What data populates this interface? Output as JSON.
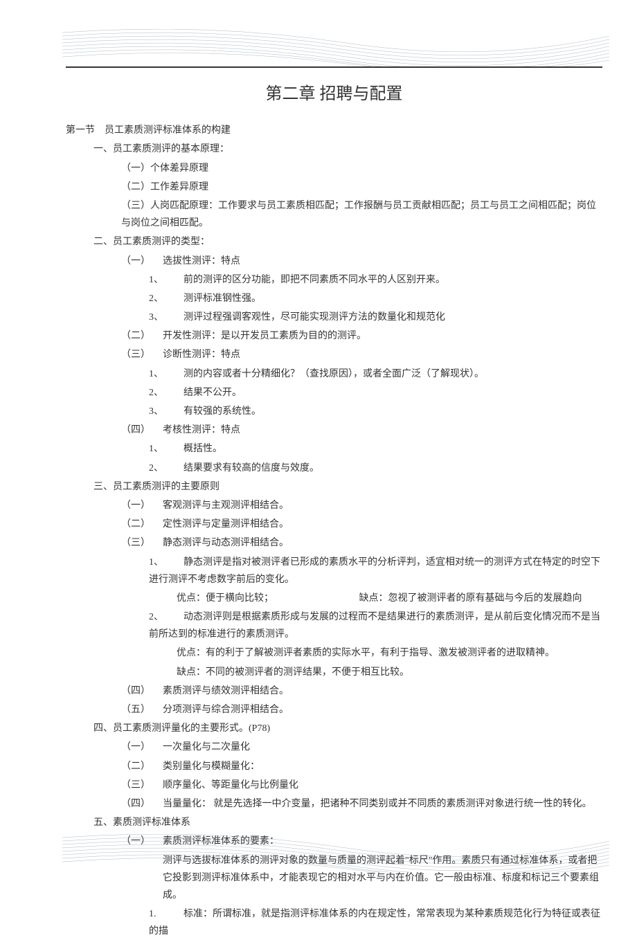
{
  "chapter_title": "第二章 招聘与配置",
  "section1": {
    "title": "第一节　员工素质测评标准体系的构建",
    "part1": {
      "heading": "一、员工素质测评的基本原理：",
      "items": [
        "（一）个体差异原理",
        "（二）工作差异原理",
        "（三）人岗匹配原理：工作要求与员工素质相匹配；工作报酬与员工贡献相匹配；员工与员工之间相匹配；岗位与岗位之间相匹配。"
      ]
    },
    "part2": {
      "heading": "二、员工素质测评的类型：",
      "sub1": {
        "label": "（一）",
        "title": "选拔性测评：特点",
        "items": [
          {
            "n": "1、",
            "t": "前的测评的区分功能，即把不同素质不同水平的人区别开来。"
          },
          {
            "n": "2、",
            "t": "测评标准钢性强。"
          },
          {
            "n": "3、",
            "t": "测评过程强调客观性，尽可能实现测评方法的数量化和规范化"
          }
        ]
      },
      "sub2": {
        "label": "（二）",
        "title": "开发性测评：是以开发员工素质为目的的测评。"
      },
      "sub3": {
        "label": "（三）",
        "title": "诊断性测评：特点",
        "items": [
          {
            "n": "1、",
            "t": "测的内容或者十分精细化？（查找原因），或者全面广泛（了解现状）。"
          },
          {
            "n": "2、",
            "t": "结果不公开。"
          },
          {
            "n": "3、",
            "t": "有较强的系统性。"
          }
        ]
      },
      "sub4": {
        "label": "（四）",
        "title": "考核性测评：特点",
        "items": [
          {
            "n": "1、",
            "t": "概括性。"
          },
          {
            "n": "2、",
            "t": "结果要求有较高的信度与效度。"
          }
        ]
      }
    },
    "part3": {
      "heading": "三、员工素质测评的主要原则",
      "sub1": {
        "label": "（一）",
        "title": "客观测评与主观测评相结合。"
      },
      "sub2": {
        "label": "（二）",
        "title": "定性测评与定量测评相结合。"
      },
      "sub3": {
        "label": "（三）",
        "title": "静态测评与动态测评相结合。",
        "item1": {
          "n": "1、",
          "t": "静态测评是指对被测评者已形成的素质水平的分析评判，适宜相对统一的测评方式在特定的时空下进行测评不考虑数字前后的变化。",
          "adv_label": "优点：便于横向比较；",
          "dis_label": "缺点：忽视了被测评者的原有基础与今后的发展趋向"
        },
        "item2": {
          "n": "2、",
          "t": "动态测评则是根据素质形成与发展的过程而不是结果进行的素质测评，是从前后变化情况而不是当前所达到的标准进行的素质测评。",
          "adv": "优点：有的利于了解被测评者素质的实际水平，有利于指导、激发被测评者的进取精神。",
          "dis": "缺点：不同的被测评者的测评结果，不便于相互比较。"
        }
      },
      "sub4": {
        "label": "（四）",
        "title": "素质测评与绩效测评相结合。"
      },
      "sub5": {
        "label": "（五）",
        "title": "分项测评与综合测评相结合。"
      }
    },
    "part4": {
      "heading": "四、员工素质测评量化的主要形式。(P78)",
      "items": [
        {
          "label": "（一）",
          "t": "一次量化与二次量化"
        },
        {
          "label": "（二）",
          "t": "类别量化与模糊量化："
        },
        {
          "label": "（三）",
          "t": "顺序量化、等距量化与比例量化"
        },
        {
          "label": "（四）",
          "t": "当量量化： 就是先选择一中介变量，把诸种不同类别或并不同质的素质测评对象进行统一性的转化。"
        }
      ]
    },
    "part5": {
      "heading": "五、素质测评标准体系",
      "sub1": {
        "label": "（一）",
        "title": "素质测评标准体系的要素：",
        "desc": "测评与选拔标准体系的测评对象的数量与质量的测评起着\"标尺\"作用。素质只有通过标准体系，或者把它投影到测评标准体系中，才能表现它的相对水平与内在价值。它一般由标准、标度和标记三个要素组成。",
        "item1": {
          "n": "1.",
          "t": "标准：所谓标准，就是指测评标准体系的内在规定性，常常表现为某种素质规范化行为特征或表征的描"
        }
      }
    }
  }
}
